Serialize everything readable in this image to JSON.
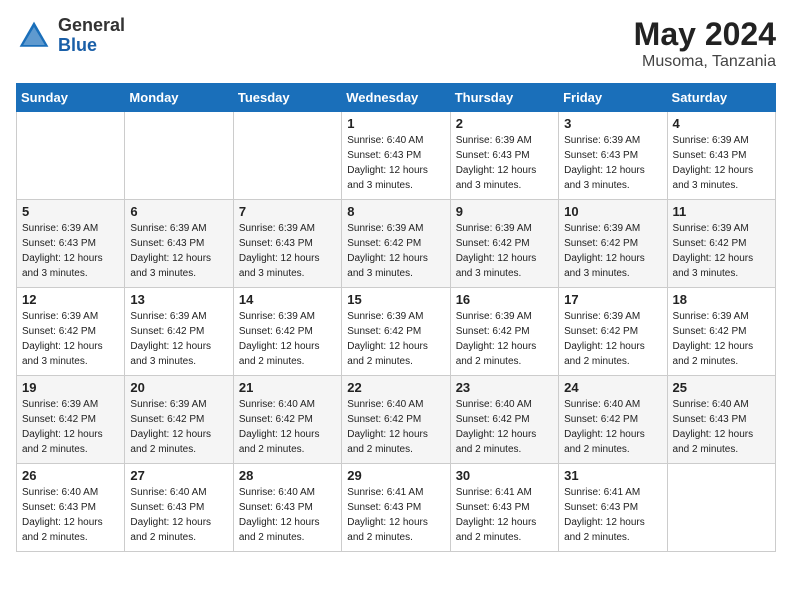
{
  "logo": {
    "general": "General",
    "blue": "Blue"
  },
  "title": {
    "month_year": "May 2024",
    "location": "Musoma, Tanzania"
  },
  "weekdays": [
    "Sunday",
    "Monday",
    "Tuesday",
    "Wednesday",
    "Thursday",
    "Friday",
    "Saturday"
  ],
  "weeks": [
    [
      {
        "day": "",
        "sunrise": "",
        "sunset": "",
        "daylight": ""
      },
      {
        "day": "",
        "sunrise": "",
        "sunset": "",
        "daylight": ""
      },
      {
        "day": "",
        "sunrise": "",
        "sunset": "",
        "daylight": ""
      },
      {
        "day": "1",
        "sunrise": "Sunrise: 6:40 AM",
        "sunset": "Sunset: 6:43 PM",
        "daylight": "Daylight: 12 hours and 3 minutes."
      },
      {
        "day": "2",
        "sunrise": "Sunrise: 6:39 AM",
        "sunset": "Sunset: 6:43 PM",
        "daylight": "Daylight: 12 hours and 3 minutes."
      },
      {
        "day": "3",
        "sunrise": "Sunrise: 6:39 AM",
        "sunset": "Sunset: 6:43 PM",
        "daylight": "Daylight: 12 hours and 3 minutes."
      },
      {
        "day": "4",
        "sunrise": "Sunrise: 6:39 AM",
        "sunset": "Sunset: 6:43 PM",
        "daylight": "Daylight: 12 hours and 3 minutes."
      }
    ],
    [
      {
        "day": "5",
        "sunrise": "Sunrise: 6:39 AM",
        "sunset": "Sunset: 6:43 PM",
        "daylight": "Daylight: 12 hours and 3 minutes."
      },
      {
        "day": "6",
        "sunrise": "Sunrise: 6:39 AM",
        "sunset": "Sunset: 6:43 PM",
        "daylight": "Daylight: 12 hours and 3 minutes."
      },
      {
        "day": "7",
        "sunrise": "Sunrise: 6:39 AM",
        "sunset": "Sunset: 6:43 PM",
        "daylight": "Daylight: 12 hours and 3 minutes."
      },
      {
        "day": "8",
        "sunrise": "Sunrise: 6:39 AM",
        "sunset": "Sunset: 6:42 PM",
        "daylight": "Daylight: 12 hours and 3 minutes."
      },
      {
        "day": "9",
        "sunrise": "Sunrise: 6:39 AM",
        "sunset": "Sunset: 6:42 PM",
        "daylight": "Daylight: 12 hours and 3 minutes."
      },
      {
        "day": "10",
        "sunrise": "Sunrise: 6:39 AM",
        "sunset": "Sunset: 6:42 PM",
        "daylight": "Daylight: 12 hours and 3 minutes."
      },
      {
        "day": "11",
        "sunrise": "Sunrise: 6:39 AM",
        "sunset": "Sunset: 6:42 PM",
        "daylight": "Daylight: 12 hours and 3 minutes."
      }
    ],
    [
      {
        "day": "12",
        "sunrise": "Sunrise: 6:39 AM",
        "sunset": "Sunset: 6:42 PM",
        "daylight": "Daylight: 12 hours and 3 minutes."
      },
      {
        "day": "13",
        "sunrise": "Sunrise: 6:39 AM",
        "sunset": "Sunset: 6:42 PM",
        "daylight": "Daylight: 12 hours and 3 minutes."
      },
      {
        "day": "14",
        "sunrise": "Sunrise: 6:39 AM",
        "sunset": "Sunset: 6:42 PM",
        "daylight": "Daylight: 12 hours and 2 minutes."
      },
      {
        "day": "15",
        "sunrise": "Sunrise: 6:39 AM",
        "sunset": "Sunset: 6:42 PM",
        "daylight": "Daylight: 12 hours and 2 minutes."
      },
      {
        "day": "16",
        "sunrise": "Sunrise: 6:39 AM",
        "sunset": "Sunset: 6:42 PM",
        "daylight": "Daylight: 12 hours and 2 minutes."
      },
      {
        "day": "17",
        "sunrise": "Sunrise: 6:39 AM",
        "sunset": "Sunset: 6:42 PM",
        "daylight": "Daylight: 12 hours and 2 minutes."
      },
      {
        "day": "18",
        "sunrise": "Sunrise: 6:39 AM",
        "sunset": "Sunset: 6:42 PM",
        "daylight": "Daylight: 12 hours and 2 minutes."
      }
    ],
    [
      {
        "day": "19",
        "sunrise": "Sunrise: 6:39 AM",
        "sunset": "Sunset: 6:42 PM",
        "daylight": "Daylight: 12 hours and 2 minutes."
      },
      {
        "day": "20",
        "sunrise": "Sunrise: 6:39 AM",
        "sunset": "Sunset: 6:42 PM",
        "daylight": "Daylight: 12 hours and 2 minutes."
      },
      {
        "day": "21",
        "sunrise": "Sunrise: 6:40 AM",
        "sunset": "Sunset: 6:42 PM",
        "daylight": "Daylight: 12 hours and 2 minutes."
      },
      {
        "day": "22",
        "sunrise": "Sunrise: 6:40 AM",
        "sunset": "Sunset: 6:42 PM",
        "daylight": "Daylight: 12 hours and 2 minutes."
      },
      {
        "day": "23",
        "sunrise": "Sunrise: 6:40 AM",
        "sunset": "Sunset: 6:42 PM",
        "daylight": "Daylight: 12 hours and 2 minutes."
      },
      {
        "day": "24",
        "sunrise": "Sunrise: 6:40 AM",
        "sunset": "Sunset: 6:42 PM",
        "daylight": "Daylight: 12 hours and 2 minutes."
      },
      {
        "day": "25",
        "sunrise": "Sunrise: 6:40 AM",
        "sunset": "Sunset: 6:43 PM",
        "daylight": "Daylight: 12 hours and 2 minutes."
      }
    ],
    [
      {
        "day": "26",
        "sunrise": "Sunrise: 6:40 AM",
        "sunset": "Sunset: 6:43 PM",
        "daylight": "Daylight: 12 hours and 2 minutes."
      },
      {
        "day": "27",
        "sunrise": "Sunrise: 6:40 AM",
        "sunset": "Sunset: 6:43 PM",
        "daylight": "Daylight: 12 hours and 2 minutes."
      },
      {
        "day": "28",
        "sunrise": "Sunrise: 6:40 AM",
        "sunset": "Sunset: 6:43 PM",
        "daylight": "Daylight: 12 hours and 2 minutes."
      },
      {
        "day": "29",
        "sunrise": "Sunrise: 6:41 AM",
        "sunset": "Sunset: 6:43 PM",
        "daylight": "Daylight: 12 hours and 2 minutes."
      },
      {
        "day": "30",
        "sunrise": "Sunrise: 6:41 AM",
        "sunset": "Sunset: 6:43 PM",
        "daylight": "Daylight: 12 hours and 2 minutes."
      },
      {
        "day": "31",
        "sunrise": "Sunrise: 6:41 AM",
        "sunset": "Sunset: 6:43 PM",
        "daylight": "Daylight: 12 hours and 2 minutes."
      },
      {
        "day": "",
        "sunrise": "",
        "sunset": "",
        "daylight": ""
      }
    ]
  ]
}
